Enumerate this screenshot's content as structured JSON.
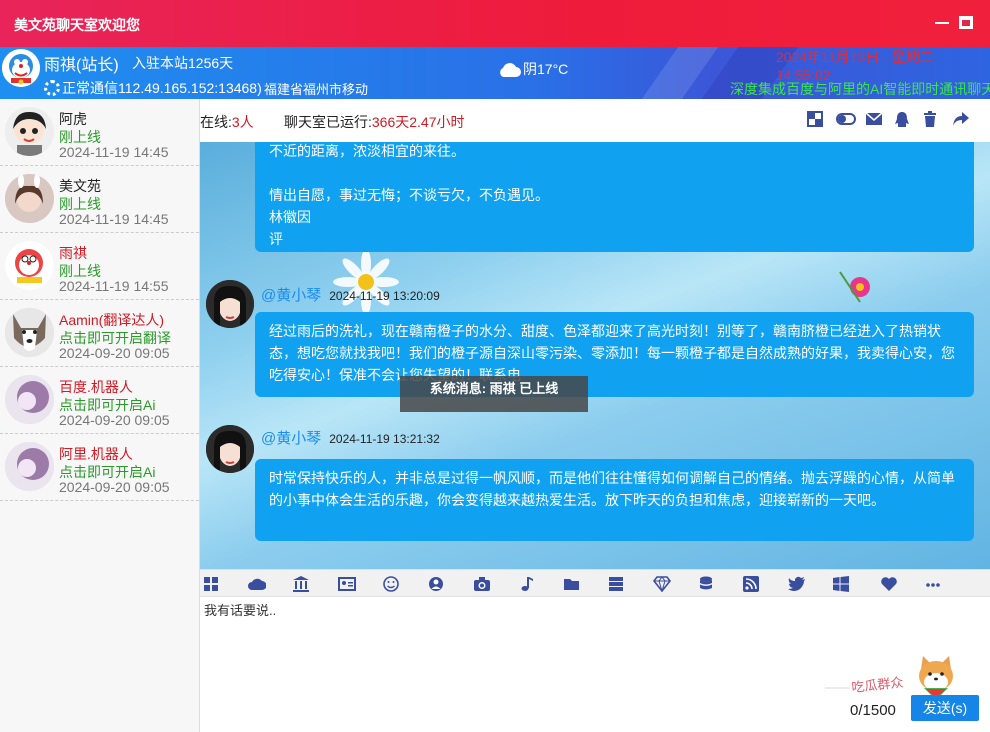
{
  "window": {
    "title": "美文苑聊天室欢迎您"
  },
  "me": {
    "name": "雨祺(站长)",
    "days": "入驻本站1256天",
    "connection": "正常通信112.49.165.152:13468)",
    "location": "福建省福州市移动"
  },
  "weather": {
    "text": "阴17°C"
  },
  "clock": {
    "text": "2024年11月19日 · 星期二 14:55:02"
  },
  "marquee": {
    "text": "深度集成百度与阿里的AI智能即时通讯聊天室"
  },
  "users": [
    {
      "name": "阿虎",
      "status": "刚上线",
      "time": "2024-11-19 14:45",
      "name_color": "normal"
    },
    {
      "name": "美文苑",
      "status": "刚上线",
      "time": "2024-11-19 14:45",
      "name_color": "normal"
    },
    {
      "name": "雨祺",
      "status": "刚上线",
      "time": "2024-11-19 14:55",
      "name_color": "red"
    },
    {
      "name": "Aamin(翻译达人)",
      "status": "点击即可开启翻译",
      "time": "2024-09-20 09:05",
      "name_color": "red"
    },
    {
      "name": "百度.机器人",
      "status": "点击即可开启Ai",
      "time": "2024-09-20 09:05",
      "name_color": "red"
    },
    {
      "name": "阿里.机器人",
      "status": "点击即可开启Ai",
      "time": "2024-09-20 09:05",
      "name_color": "red"
    }
  ],
  "toolbar": {
    "online_label": "在线:",
    "online_count": "3人",
    "run_label": "聊天室已运行:",
    "run_value": "366天2.47小时",
    "icons": [
      "layout-icon",
      "toggle-icon",
      "mail-icon",
      "qq-icon",
      "trash-icon",
      "share-icon"
    ]
  },
  "messages": [
    {
      "lines": [
        "不近的距离，浓淡相宜的来往。",
        "",
        "情出自愿，事过无悔；不谈亏欠，不负遇见。",
        "林徽因",
        "评"
      ]
    },
    {
      "sender": "@黄小琴",
      "time": "2024-11-19 13:20:09",
      "text": "经过雨后的洗礼，现在赣南橙子的水分、甜度、色泽都迎来了高光时刻！别等了，赣南脐橙已经进入了热销状态，想吃您就找我吧！我们的橙子源自深山零污染、零添加！每一颗橙子都是自然成熟的好果，我卖得心安，您吃得安心！保准不会让您失望的！联系电"
    },
    {
      "sender": "@黄小琴",
      "time": "2024-11-19 13:21:32",
      "text": "时常保持快乐的人，并非总是过得一帆风顺，而是他们往往懂得如何调解自己的情绪。抛去浮躁的心情，从简单的小事中体会生活的乐趣，你会变得越来越热爱生活。放下昨天的负担和焦虑，迎接崭新的一天吧。"
    }
  ],
  "system_message": "系统消息: 雨祺 已上线",
  "emoji_bar": [
    "apps-icon",
    "cloud-icon",
    "bank-icon",
    "id-card-icon",
    "smile-icon",
    "user-circle-icon",
    "camera-icon",
    "music-icon",
    "folder-icon",
    "server-icon",
    "diamond-icon",
    "database-icon",
    "rss-icon",
    "twitter-icon",
    "windows-icon",
    "heart-icon",
    "more-icon"
  ],
  "compose": {
    "placeholder": "我有话要说..",
    "counter": "0/1500",
    "send_label": "发送(s)"
  },
  "brand": {
    "accent": "#e8245a",
    "blue": "#10a2f1"
  }
}
